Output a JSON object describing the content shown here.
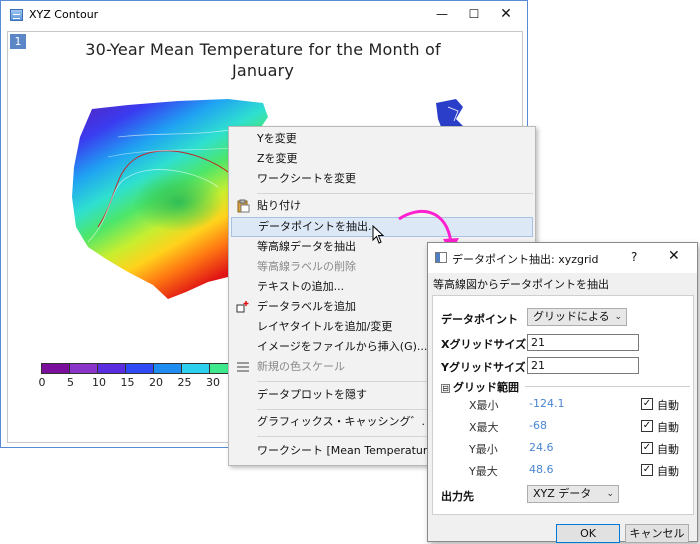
{
  "main_window": {
    "title": "XYZ Contour",
    "controls": {
      "minimize": "—",
      "maximize": "☐",
      "close": "✕"
    }
  },
  "graph": {
    "layer_number": "1",
    "title_line1": "30-Year Mean Temperature for the Month of",
    "title_line2": "January",
    "color_scale": {
      "colors": [
        "#7a0f9c",
        "#8a35c8",
        "#5a2ee0",
        "#2f49f5",
        "#1f8cf2",
        "#2ed0f0",
        "#3fe88d",
        "#3ec23a"
      ],
      "labels": [
        "0",
        "5",
        "10",
        "15",
        "20",
        "25",
        "30"
      ]
    },
    "contour_colors": {
      "cold": "#7a1fa6",
      "mid": "#3fc66a",
      "hot": "#e21b1b",
      "accent_contour": "#c02a2a"
    }
  },
  "context_menu": {
    "items": [
      {
        "label": "Yを変更",
        "disabled": false
      },
      {
        "label": "Zを変更",
        "disabled": false
      },
      {
        "label": "ワークシートを変更",
        "disabled": false
      },
      {
        "label": "貼り付け",
        "disabled": false,
        "icon": "paste-icon"
      },
      {
        "label": "データポイントを抽出...",
        "disabled": false,
        "highlight": true
      },
      {
        "label": "等高線データを抽出",
        "disabled": false
      },
      {
        "label": "等高線ラベルの削除",
        "disabled": true
      },
      {
        "label": "テキストの追加...",
        "disabled": false
      },
      {
        "label": "データラベルを追加",
        "disabled": false,
        "icon": "data-label-icon"
      },
      {
        "label": "レイヤタイトルを追加/変更",
        "disabled": false
      },
      {
        "label": "イメージをファイルから挿入(G)...",
        "disabled": false
      },
      {
        "label": "新規の色スケール",
        "disabled": true,
        "icon": "color-scale-icon"
      },
      {
        "label": "データプロットを隠す",
        "disabled": false
      },
      {
        "label": "グラフィックス・キャッシング゛.",
        "disabled": false
      },
      {
        "label": "ワークシート [Mean Temperature for",
        "disabled": false
      }
    ]
  },
  "dialog": {
    "title": "データポイント抽出: xyzgrid",
    "help": "?",
    "close": "✕",
    "description": "等高線図からデータポイントを抽出",
    "data_points_label": "データポイント",
    "data_points_value": "グリッドによる",
    "x_grid_label": "Xグリッドサイズ",
    "x_grid_value": "21",
    "y_grid_label": "Yグリッドサイズ",
    "y_grid_value": "21",
    "grid_range_label": "グリッド範囲",
    "grid_range_toggle": "⊟",
    "ranges": [
      {
        "label": "X最小",
        "value": "-124.1",
        "auto": "自動"
      },
      {
        "label": "X最大",
        "value": "-68",
        "auto": "自動"
      },
      {
        "label": "Y最小",
        "value": "24.6",
        "auto": "自動"
      },
      {
        "label": "Y最大",
        "value": "48.6",
        "auto": "自動"
      }
    ],
    "check_mark": "☑",
    "output_label": "出力先",
    "output_value": "XYZ データ",
    "ok_label": "OK",
    "cancel_label": "キャンセル"
  }
}
